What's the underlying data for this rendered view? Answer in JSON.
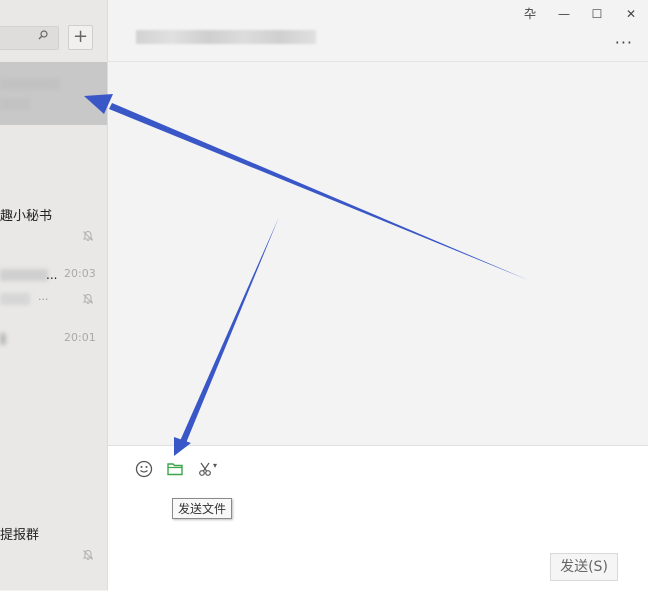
{
  "sidebar": {
    "add_button_label": "+",
    "conversations": [
      {
        "name": "",
        "selected": true
      },
      {
        "name": "趣小秘书",
        "muted": true
      },
      {
        "name": "...",
        "time": "20:03",
        "preview": "...",
        "muted": true
      },
      {
        "name": "",
        "time": "20:01"
      },
      {
        "name": "提报群",
        "muted": true
      }
    ]
  },
  "window": {
    "pin_icon": "卆",
    "minimize_icon": "—",
    "maximize_icon": "☐",
    "close_icon": "✕",
    "more_icon": "···"
  },
  "toolbar": {
    "send_file_tooltip": "发送文件",
    "scissors_caret": "▾"
  },
  "send_button_label": "发送(S)",
  "colors": {
    "arrow": "#3a57c8",
    "folder_icon": "#3aa54a",
    "sidebar_bg": "#e9e8e7",
    "selected_bg": "#c9c8c8"
  }
}
